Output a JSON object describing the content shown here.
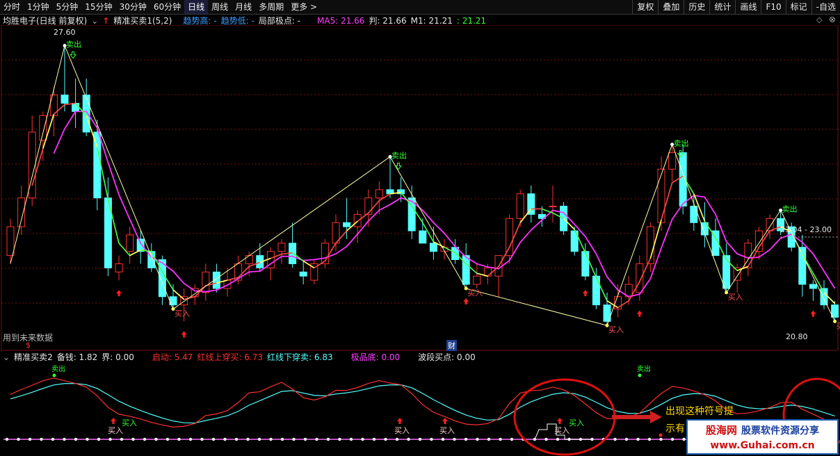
{
  "toolbar": {
    "tabs": [
      "分时",
      "1分钟",
      "5分钟",
      "15分钟",
      "30分钟",
      "60分钟",
      "日线",
      "周线",
      "月线",
      "多周期",
      "更多 >"
    ],
    "active_tab": "日线",
    "right_buttons": [
      "复权",
      "叠加",
      "历史",
      "统计",
      "画线",
      "F10",
      "标记",
      "-自选"
    ]
  },
  "main_header": {
    "stock": "均胜电子(日线 前复权)",
    "indicator": "精准买卖1(5,2)",
    "trend_high": "趋势高: -",
    "trend_low": "趋势低: -",
    "local_extreme": "局部极点: -",
    "ma5": "MA5: 21.66",
    "judge": "判: 21.66",
    "m1": "M1: 21.21",
    "colon_val": ": 21.21"
  },
  "main_chart": {
    "price_high_label": "27.60",
    "price_low_label": "20.80",
    "range_label": "23.04 - 23.00",
    "future_data_note": "用到未来数据",
    "dollar_marker": "$",
    "fin_marker": "财",
    "sell_label": "卖出",
    "buy_label": "买入"
  },
  "sub_header": {
    "indicator": "精准买卖2",
    "reserve": "备钱: 1.82",
    "boundary": "界: 0.00",
    "start": "启动: 5.47",
    "red_cross_buy": "红线上穿买: 6.73",
    "red_cross_sell": "红线下穿卖: 6.83",
    "extreme_low": "极品底: 0.00",
    "wave_buy": "波段买点: 0.00"
  },
  "sub_chart": {
    "buy_label": "买入",
    "sell_top_label": "卖出",
    "annotation_line1": "出现这种符号提",
    "annotation_line2": "示有"
  },
  "watermark": {
    "site_name": "股海网",
    "slogan": "股票软件资源分享",
    "url": "www.Guhai.com.cn"
  },
  "colors": {
    "up_candle": "#ff3232",
    "down_candle": "#54ffff",
    "ma_white": "#ffffff",
    "ma_magenta": "#ff32ff",
    "ma_yellow": "#ffff54",
    "ma_green": "#32ff32",
    "grid": "#7a1010",
    "annotation": "#ffd700",
    "highlight_circle": "#e01010"
  },
  "chart_data": {
    "type": "candlestick",
    "y_range": [
      20.5,
      28.0
    ],
    "ohlc": [
      [
        22.5,
        23.4,
        22.3,
        23.2
      ],
      [
        23.2,
        24.2,
        23.0,
        23.9
      ],
      [
        23.9,
        25.9,
        23.7,
        25.5
      ],
      [
        25.3,
        26.0,
        24.8,
        25.9
      ],
      [
        25.9,
        26.6,
        25.4,
        26.4
      ],
      [
        26.4,
        27.6,
        26.0,
        26.2
      ],
      [
        26.2,
        26.8,
        25.6,
        26.0
      ],
      [
        26.4,
        26.8,
        25.4,
        25.5
      ],
      [
        25.5,
        25.8,
        23.6,
        23.9
      ],
      [
        23.9,
        24.4,
        22.0,
        22.2
      ],
      [
        22.1,
        22.5,
        21.9,
        22.3
      ],
      [
        22.6,
        23.2,
        22.3,
        23.0
      ],
      [
        22.9,
        23.1,
        22.3,
        22.6
      ],
      [
        22.6,
        22.8,
        22.1,
        22.2
      ],
      [
        22.4,
        22.5,
        21.3,
        21.5
      ],
      [
        21.5,
        21.8,
        21.2,
        21.3
      ],
      [
        21.3,
        21.7,
        20.9,
        21.5
      ],
      [
        21.5,
        21.8,
        21.3,
        21.7
      ],
      [
        21.6,
        22.3,
        21.4,
        22.1
      ],
      [
        22.1,
        22.3,
        21.6,
        21.7
      ],
      [
        21.7,
        22.2,
        21.5,
        21.9
      ],
      [
        21.9,
        22.5,
        21.8,
        22.3
      ],
      [
        22.3,
        22.6,
        22.0,
        22.5
      ],
      [
        22.5,
        22.8,
        22.1,
        22.2
      ],
      [
        22.2,
        22.7,
        21.9,
        22.6
      ],
      [
        22.6,
        22.9,
        22.3,
        22.8
      ],
      [
        22.8,
        23.3,
        22.2,
        22.3
      ],
      [
        22.1,
        22.4,
        21.8,
        22.0
      ],
      [
        21.9,
        22.4,
        21.8,
        22.3
      ],
      [
        22.3,
        22.9,
        22.2,
        22.8
      ],
      [
        22.8,
        23.5,
        22.6,
        23.3
      ],
      [
        23.3,
        23.9,
        22.9,
        23.2
      ],
      [
        23.2,
        23.6,
        22.8,
        23.5
      ],
      [
        23.5,
        24.1,
        23.2,
        23.9
      ],
      [
        23.9,
        24.3,
        23.5,
        24.1
      ],
      [
        24.1,
        24.9,
        23.9,
        24.0
      ],
      [
        24.1,
        24.4,
        23.8,
        24.0
      ],
      [
        23.9,
        24.2,
        22.9,
        23.1
      ],
      [
        23.1,
        23.4,
        22.8,
        22.8
      ],
      [
        22.8,
        23.2,
        22.4,
        22.6
      ],
      [
        22.6,
        22.9,
        22.4,
        22.7
      ],
      [
        22.7,
        22.9,
        22.3,
        22.4
      ],
      [
        22.5,
        22.8,
        21.7,
        21.8
      ],
      [
        21.8,
        22.3,
        21.7,
        22.0
      ],
      [
        22.0,
        22.3,
        21.8,
        22.2
      ],
      [
        22.0,
        22.5,
        21.5,
        22.5
      ],
      [
        22.5,
        23.5,
        22.3,
        23.4
      ],
      [
        23.4,
        24.1,
        23.2,
        24.0
      ],
      [
        24.0,
        24.2,
        23.3,
        23.5
      ],
      [
        23.5,
        23.7,
        23.2,
        23.4
      ],
      [
        23.7,
        24.2,
        23.3,
        23.7
      ],
      [
        23.7,
        23.8,
        23.0,
        23.1
      ],
      [
        23.1,
        23.2,
        22.5,
        22.6
      ],
      [
        22.6,
        22.8,
        21.9,
        22.0
      ],
      [
        22.0,
        22.2,
        21.2,
        21.3
      ],
      [
        21.3,
        21.6,
        20.8,
        20.9
      ],
      [
        21.2,
        21.8,
        21.0,
        21.5
      ],
      [
        21.5,
        22.0,
        21.3,
        21.8
      ],
      [
        21.6,
        22.5,
        21.4,
        22.3
      ],
      [
        22.3,
        23.3,
        22.1,
        23.2
      ],
      [
        23.3,
        24.9,
        23.1,
        24.6
      ],
      [
        24.6,
        25.2,
        24.3,
        25.0
      ],
      [
        25.0,
        25.2,
        23.5,
        23.7
      ],
      [
        23.7,
        24.0,
        23.1,
        23.3
      ],
      [
        23.3,
        23.8,
        22.7,
        23.0
      ],
      [
        23.1,
        23.4,
        22.5,
        22.5
      ],
      [
        22.5,
        22.8,
        21.6,
        21.7
      ],
      [
        21.9,
        22.3,
        21.6,
        22.2
      ],
      [
        22.2,
        22.9,
        22.0,
        22.8
      ],
      [
        22.6,
        23.2,
        22.4,
        23.1
      ],
      [
        23.1,
        23.5,
        22.9,
        23.4
      ],
      [
        23.4,
        23.6,
        23.0,
        23.1
      ],
      [
        23.2,
        23.3,
        22.6,
        22.7
      ],
      [
        22.7,
        23.0,
        21.5,
        21.8
      ],
      [
        21.8,
        21.9,
        21.4,
        21.7
      ],
      [
        21.7,
        21.9,
        21.2,
        21.3
      ],
      [
        21.3,
        21.4,
        20.9,
        21.0
      ]
    ]
  }
}
